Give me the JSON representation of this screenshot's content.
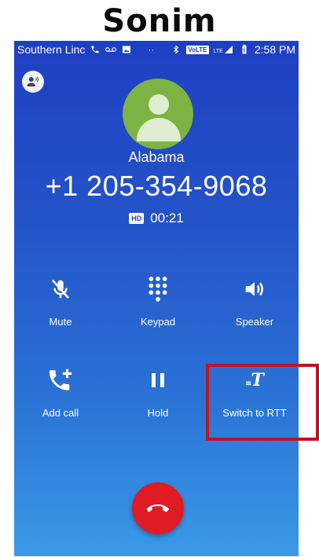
{
  "brand": "Sonim",
  "status_bar": {
    "carrier": "Southern Linc",
    "time": "2:58 PM",
    "network_badge": "VoLTE",
    "lte": "LTE",
    "icons": [
      "phone-icon",
      "voicemail-icon",
      "image-icon",
      "more-icon",
      "bluetooth-icon",
      "signal-icon",
      "battery-icon"
    ]
  },
  "call": {
    "location": "Alabama",
    "number": "+1 205-354-9068",
    "hd_badge": "HD",
    "duration": "00:21"
  },
  "controls": [
    {
      "label": "Mute",
      "icon": "mic-off-icon"
    },
    {
      "label": "Keypad",
      "icon": "dialpad-icon"
    },
    {
      "label": "Speaker",
      "icon": "speaker-icon"
    },
    {
      "label": "Add call",
      "icon": "add-call-icon"
    },
    {
      "label": "Hold",
      "icon": "pause-icon"
    },
    {
      "label": "Switch to RTT",
      "icon": "rtt-icon"
    }
  ],
  "end_call_icon": "end-call-icon",
  "colors": {
    "background_top": "#1f3fc2",
    "background_bottom": "#3a9ae6",
    "avatar": "#7cb342",
    "end_call": "#e01b24",
    "highlight": "#c1121f"
  }
}
